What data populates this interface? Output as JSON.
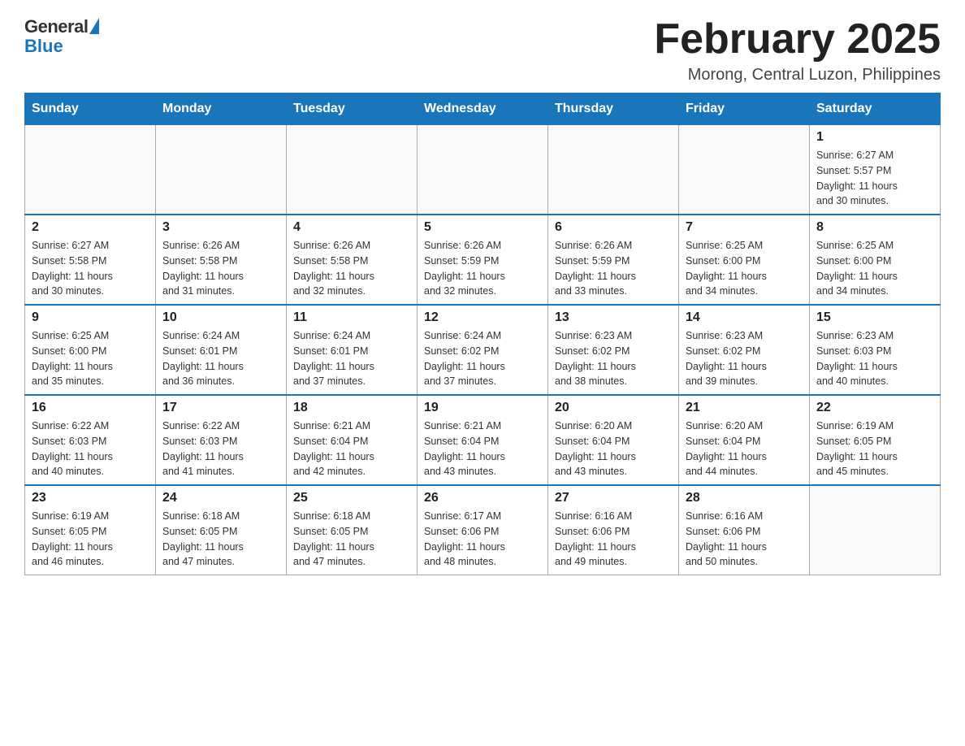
{
  "header": {
    "logo_general": "General",
    "logo_blue": "Blue",
    "month_title": "February 2025",
    "location": "Morong, Central Luzon, Philippines"
  },
  "days_of_week": [
    "Sunday",
    "Monday",
    "Tuesday",
    "Wednesday",
    "Thursday",
    "Friday",
    "Saturday"
  ],
  "weeks": [
    [
      {
        "day": "",
        "info": ""
      },
      {
        "day": "",
        "info": ""
      },
      {
        "day": "",
        "info": ""
      },
      {
        "day": "",
        "info": ""
      },
      {
        "day": "",
        "info": ""
      },
      {
        "day": "",
        "info": ""
      },
      {
        "day": "1",
        "info": "Sunrise: 6:27 AM\nSunset: 5:57 PM\nDaylight: 11 hours\nand 30 minutes."
      }
    ],
    [
      {
        "day": "2",
        "info": "Sunrise: 6:27 AM\nSunset: 5:58 PM\nDaylight: 11 hours\nand 30 minutes."
      },
      {
        "day": "3",
        "info": "Sunrise: 6:26 AM\nSunset: 5:58 PM\nDaylight: 11 hours\nand 31 minutes."
      },
      {
        "day": "4",
        "info": "Sunrise: 6:26 AM\nSunset: 5:58 PM\nDaylight: 11 hours\nand 32 minutes."
      },
      {
        "day": "5",
        "info": "Sunrise: 6:26 AM\nSunset: 5:59 PM\nDaylight: 11 hours\nand 32 minutes."
      },
      {
        "day": "6",
        "info": "Sunrise: 6:26 AM\nSunset: 5:59 PM\nDaylight: 11 hours\nand 33 minutes."
      },
      {
        "day": "7",
        "info": "Sunrise: 6:25 AM\nSunset: 6:00 PM\nDaylight: 11 hours\nand 34 minutes."
      },
      {
        "day": "8",
        "info": "Sunrise: 6:25 AM\nSunset: 6:00 PM\nDaylight: 11 hours\nand 34 minutes."
      }
    ],
    [
      {
        "day": "9",
        "info": "Sunrise: 6:25 AM\nSunset: 6:00 PM\nDaylight: 11 hours\nand 35 minutes."
      },
      {
        "day": "10",
        "info": "Sunrise: 6:24 AM\nSunset: 6:01 PM\nDaylight: 11 hours\nand 36 minutes."
      },
      {
        "day": "11",
        "info": "Sunrise: 6:24 AM\nSunset: 6:01 PM\nDaylight: 11 hours\nand 37 minutes."
      },
      {
        "day": "12",
        "info": "Sunrise: 6:24 AM\nSunset: 6:02 PM\nDaylight: 11 hours\nand 37 minutes."
      },
      {
        "day": "13",
        "info": "Sunrise: 6:23 AM\nSunset: 6:02 PM\nDaylight: 11 hours\nand 38 minutes."
      },
      {
        "day": "14",
        "info": "Sunrise: 6:23 AM\nSunset: 6:02 PM\nDaylight: 11 hours\nand 39 minutes."
      },
      {
        "day": "15",
        "info": "Sunrise: 6:23 AM\nSunset: 6:03 PM\nDaylight: 11 hours\nand 40 minutes."
      }
    ],
    [
      {
        "day": "16",
        "info": "Sunrise: 6:22 AM\nSunset: 6:03 PM\nDaylight: 11 hours\nand 40 minutes."
      },
      {
        "day": "17",
        "info": "Sunrise: 6:22 AM\nSunset: 6:03 PM\nDaylight: 11 hours\nand 41 minutes."
      },
      {
        "day": "18",
        "info": "Sunrise: 6:21 AM\nSunset: 6:04 PM\nDaylight: 11 hours\nand 42 minutes."
      },
      {
        "day": "19",
        "info": "Sunrise: 6:21 AM\nSunset: 6:04 PM\nDaylight: 11 hours\nand 43 minutes."
      },
      {
        "day": "20",
        "info": "Sunrise: 6:20 AM\nSunset: 6:04 PM\nDaylight: 11 hours\nand 43 minutes."
      },
      {
        "day": "21",
        "info": "Sunrise: 6:20 AM\nSunset: 6:04 PM\nDaylight: 11 hours\nand 44 minutes."
      },
      {
        "day": "22",
        "info": "Sunrise: 6:19 AM\nSunset: 6:05 PM\nDaylight: 11 hours\nand 45 minutes."
      }
    ],
    [
      {
        "day": "23",
        "info": "Sunrise: 6:19 AM\nSunset: 6:05 PM\nDaylight: 11 hours\nand 46 minutes."
      },
      {
        "day": "24",
        "info": "Sunrise: 6:18 AM\nSunset: 6:05 PM\nDaylight: 11 hours\nand 47 minutes."
      },
      {
        "day": "25",
        "info": "Sunrise: 6:18 AM\nSunset: 6:05 PM\nDaylight: 11 hours\nand 47 minutes."
      },
      {
        "day": "26",
        "info": "Sunrise: 6:17 AM\nSunset: 6:06 PM\nDaylight: 11 hours\nand 48 minutes."
      },
      {
        "day": "27",
        "info": "Sunrise: 6:16 AM\nSunset: 6:06 PM\nDaylight: 11 hours\nand 49 minutes."
      },
      {
        "day": "28",
        "info": "Sunrise: 6:16 AM\nSunset: 6:06 PM\nDaylight: 11 hours\nand 50 minutes."
      },
      {
        "day": "",
        "info": ""
      }
    ]
  ]
}
